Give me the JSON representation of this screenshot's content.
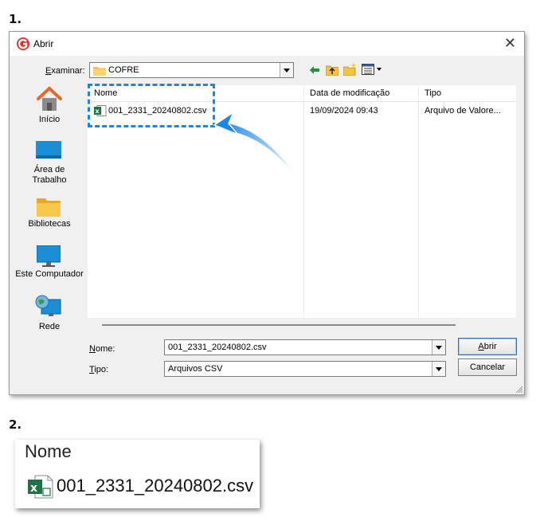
{
  "steps": {
    "one": "1.",
    "two": "2."
  },
  "dialog": {
    "title": "Abrir",
    "look_in_label_prefix": "E",
    "look_in_label_rest": "xaminar:",
    "look_in_value": "COFRE",
    "places": [
      {
        "label": "Início"
      },
      {
        "label": "Área de\nTrabalho"
      },
      {
        "label": "Bibliotecas"
      },
      {
        "label": "Este Computador"
      },
      {
        "label": "Rede"
      }
    ],
    "columns": {
      "name": "Nome",
      "date": "Data de modificação",
      "type": "Tipo"
    },
    "files": [
      {
        "name": "001_2331_20240802.csv",
        "date": "19/09/2024 09:43",
        "type": "Arquivo de Valore..."
      }
    ],
    "filename_label_prefix": "N",
    "filename_label_rest": "ome:",
    "filename_value": "001_2331_20240802.csv",
    "filetype_label_prefix": "T",
    "filetype_label_rest": "ipo:",
    "filetype_value": "Arquivos CSV",
    "open_button_prefix": "A",
    "open_button_rest": "brir",
    "cancel_button": "Cancelar"
  },
  "zoom": {
    "header": "Nome",
    "file": "001_2331_20240802.csv"
  },
  "colors": {
    "accent": "#1c86e8",
    "folder": "#f5c242",
    "excel": "#1f7244"
  }
}
